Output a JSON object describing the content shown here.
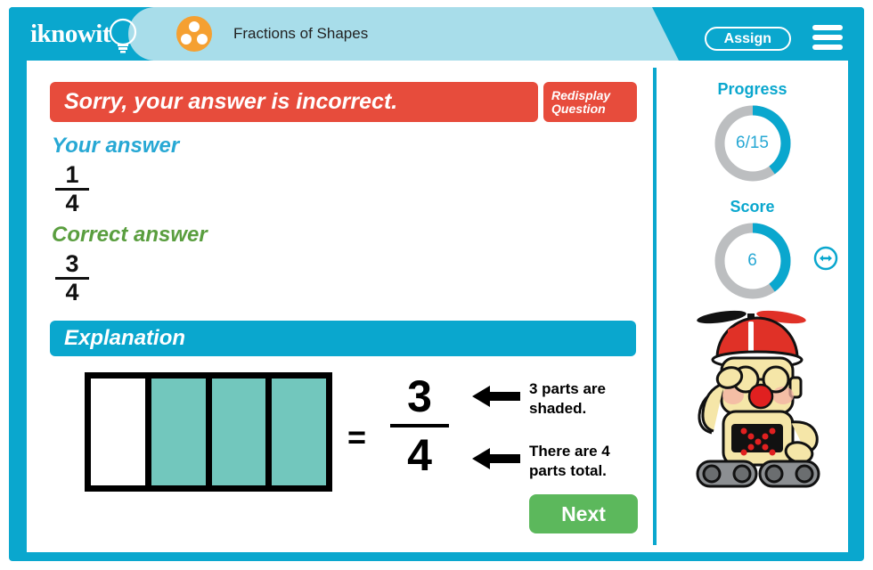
{
  "header": {
    "logo_text": "iknowit",
    "logo_icon": "lightbulb-icon",
    "subject_icon": "three-dots-circle-icon",
    "subject_title": "Fractions of Shapes",
    "assign_label": "Assign",
    "menu_icon": "hamburger-menu-icon",
    "bg_color": "#0aa7ce",
    "pill_color": "#a8ddea",
    "subject_icon_color": "#f5a031"
  },
  "result": {
    "message": "Sorry, your answer is incorrect.",
    "banner_color": "#e74c3c",
    "redisplay_line1": "Redisplay",
    "redisplay_line2": "Question"
  },
  "answers": {
    "your_label": "Your answer",
    "your_label_color": "#27a8d4",
    "your_numerator": "1",
    "your_denominator": "4",
    "correct_label": "Correct answer",
    "correct_label_color": "#5a9e3f",
    "correct_numerator": "3",
    "correct_denominator": "4"
  },
  "explanation": {
    "title": "Explanation",
    "header_color": "#0aa7ce",
    "shape": {
      "total_parts": 4,
      "shaded_parts": 3,
      "shaded_color": "#72c7bd",
      "unshaded_color": "#ffffff",
      "outline_color": "#000000"
    },
    "equals_sign": "=",
    "fraction_numerator": "3",
    "fraction_denominator": "4",
    "note_1_line1": "3 parts are",
    "note_1_line2": "shaded.",
    "note_2_line1": "There are 4",
    "note_2_line2": "parts total.",
    "arrow_1_icon": "left-arrow-icon",
    "arrow_2_icon": "left-arrow-icon"
  },
  "next_button": {
    "label": "Next",
    "color": "#5cb85c"
  },
  "sidebar": {
    "progress": {
      "title": "Progress",
      "value": "6/15",
      "completed": 6,
      "total": 15,
      "percent": 40,
      "arc_color": "#0aa7ce",
      "track_color": "#bcbec0"
    },
    "score": {
      "title": "Score",
      "value": "6",
      "percent": 40,
      "arc_color": "#0aa7ce",
      "track_color": "#bcbec0"
    },
    "mascot_icon": "robot-mascot-propeller-hat-icon",
    "resize_icon": "resize-horizontal-icon",
    "resize_icon_color": "#0aa7ce"
  }
}
